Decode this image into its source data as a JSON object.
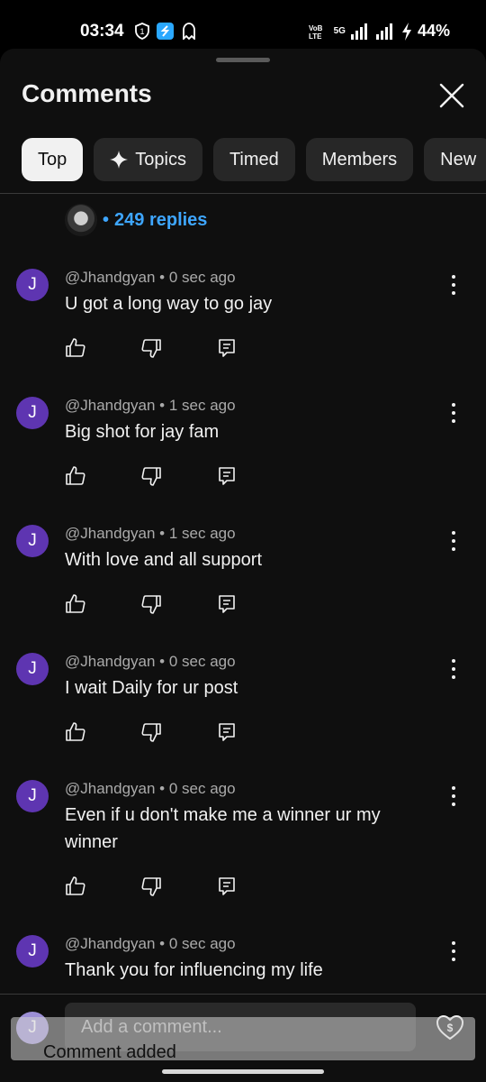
{
  "status": {
    "time": "03:34",
    "network": "5G",
    "battery": "44%"
  },
  "header": {
    "title": "Comments"
  },
  "chips": [
    {
      "label": "Top",
      "icon": ""
    },
    {
      "label": "Topics",
      "icon": "sparkle-icon"
    },
    {
      "label": "Timed",
      "icon": ""
    },
    {
      "label": "Members",
      "icon": ""
    },
    {
      "label": "New",
      "icon": ""
    }
  ],
  "replies": {
    "label": "249 replies"
  },
  "comments": [
    {
      "avatar": "J",
      "author": "@Jhandgyan",
      "time": "0 sec ago",
      "text": "U got a long way to go jay"
    },
    {
      "avatar": "J",
      "author": "@Jhandgyan",
      "time": "1 sec ago",
      "text": "Big shot for jay fam"
    },
    {
      "avatar": "J",
      "author": "@Jhandgyan",
      "time": "1 sec ago",
      "text": "With love and all support"
    },
    {
      "avatar": "J",
      "author": "@Jhandgyan",
      "time": "0 sec ago",
      "text": "I wait Daily for ur post"
    },
    {
      "avatar": "J",
      "author": "@Jhandgyan",
      "time": "0 sec ago",
      "text": "Even if u don't make me a winner ur my winner"
    },
    {
      "avatar": "J",
      "author": "@Jhandgyan",
      "time": "0 sec ago",
      "text": "Thank you for influencing my life"
    }
  ],
  "composer": {
    "avatar": "J",
    "placeholder": "Add a comment..."
  },
  "toast": {
    "text": "Comment added"
  },
  "colors": {
    "background": "#0f0f0f",
    "chip": "#272727",
    "link": "#3ea6ff",
    "avatar": "#5e35b1"
  }
}
